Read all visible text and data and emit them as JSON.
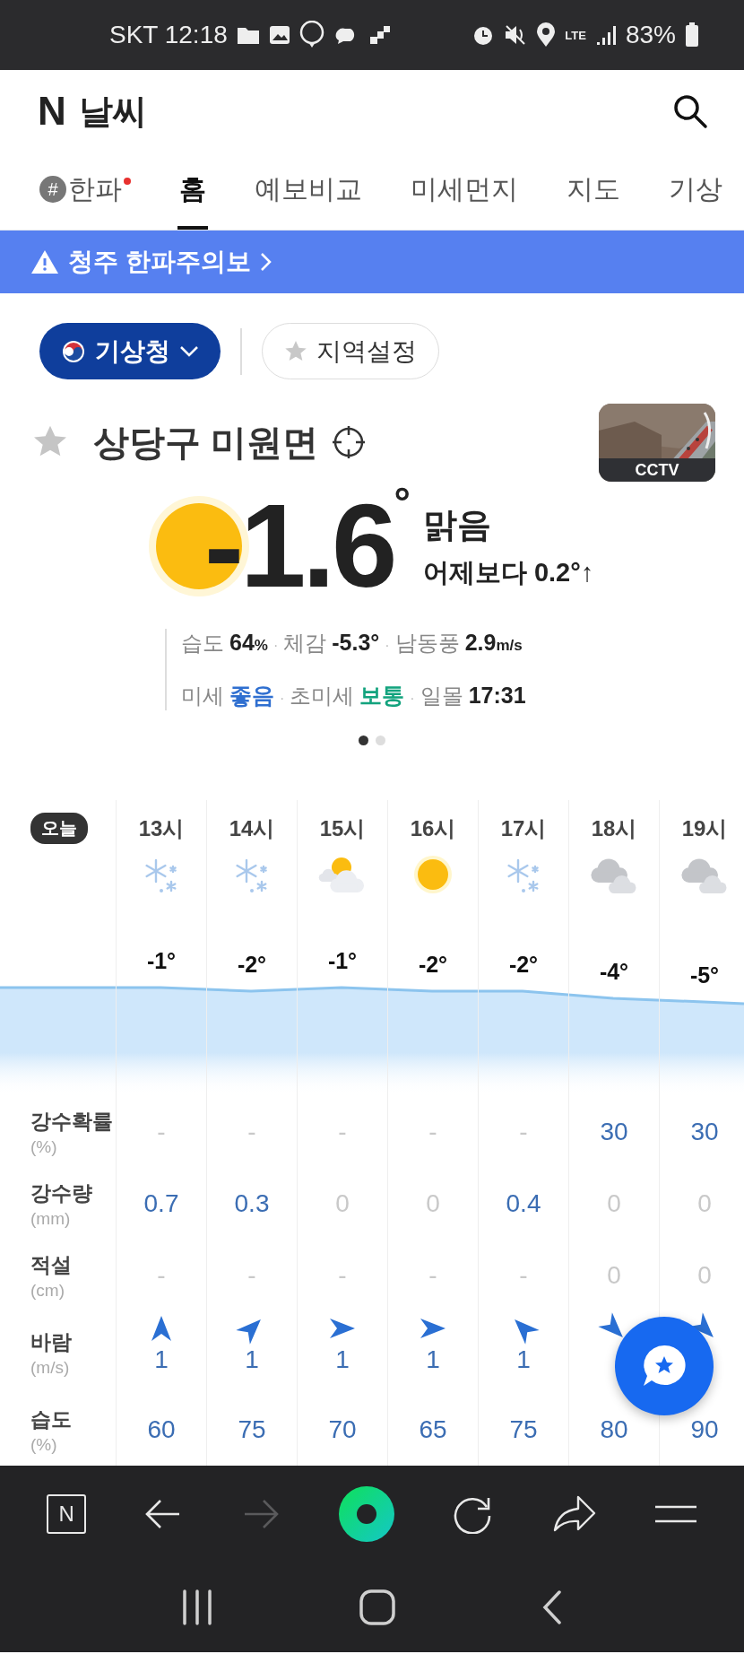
{
  "status_bar": {
    "carrier_time": "SKT 12:18",
    "network": "LTE",
    "battery": "83%"
  },
  "header": {
    "logo": "N",
    "title": "날씨"
  },
  "tabs": [
    {
      "hashtag": "#",
      "label": "한파",
      "alert": true,
      "selected": false
    },
    {
      "label": "홈",
      "alert": false,
      "selected": true
    },
    {
      "label": "예보비교",
      "alert": false,
      "selected": false
    },
    {
      "label": "미세먼지",
      "alert": false,
      "selected": false
    },
    {
      "label": "지도",
      "alert": false,
      "selected": false
    },
    {
      "label": "기상",
      "alert": false,
      "selected": false
    }
  ],
  "banner": {
    "text": "청주 한파주의보"
  },
  "source_button": {
    "label": "기상청"
  },
  "region_button": {
    "label": "지역설정"
  },
  "location": {
    "name": "상당구 미원면",
    "favorite": false
  },
  "cctv": {
    "label": "CCTV"
  },
  "current": {
    "kind": "sun",
    "temperature": "-1.6$^{°}$",
    "condition": "맑음",
    "comparison": "어제보다 0.2°↑"
  },
  "details": {
    "separator": "·",
    "lines": [
      [
        {
          "label": "습도",
          "value": "64",
          "unit": "%",
          "color": "#222222"
        },
        {
          "label": "체감",
          "value": "-5.3°",
          "color": "#222222"
        },
        {
          "label": "남동풍",
          "value": "2.9",
          "unit": "m/s",
          "color": "#222222"
        }
      ],
      [
        {
          "label": "미세",
          "value": "좋음",
          "color": "#2f6fd0"
        },
        {
          "label": "초미세",
          "value": "보통",
          "color": "#13a37e"
        },
        {
          "label": "일몰",
          "value": "17:31",
          "color": "#222222"
        }
      ]
    ]
  },
  "pager": [
    {
      "selected": true
    },
    {
      "selected": false
    }
  ],
  "hourly": {
    "day_label": "오늘",
    "hours": [
      {
        "time": "13시",
        "kind": "snow",
        "temp": "-1°"
      },
      {
        "time": "14시",
        "kind": "snow",
        "temp": "-2°"
      },
      {
        "time": "15시",
        "kind": "partly-cloudy",
        "temp": "-1°"
      },
      {
        "time": "16시",
        "kind": "sun",
        "temp": "-2°"
      },
      {
        "time": "17시",
        "kind": "snow",
        "temp": "-2°"
      },
      {
        "time": "18시",
        "kind": "cloudy",
        "temp": "-4°"
      },
      {
        "time": "19시",
        "kind": "cloudy",
        "temp": "-5°"
      }
    ]
  },
  "rows": [
    {
      "label": "강수확률",
      "unit": "(%)",
      "kind": "value",
      "cells": [
        {
          "text": "-",
          "dim": true
        },
        {
          "text": "-",
          "dim": true
        },
        {
          "text": "-",
          "dim": true
        },
        {
          "text": "-",
          "dim": true
        },
        {
          "text": "-",
          "dim": true
        },
        {
          "text": "30",
          "dim": false
        },
        {
          "text": "30",
          "dim": false
        }
      ]
    },
    {
      "label": "강수량",
      "unit": "(mm)",
      "kind": "value",
      "cells": [
        {
          "text": "0.7",
          "dim": false
        },
        {
          "text": "0.3",
          "dim": false
        },
        {
          "text": "0",
          "dim": true
        },
        {
          "text": "0",
          "dim": true
        },
        {
          "text": "0.4",
          "dim": false
        },
        {
          "text": "0",
          "dim": true
        },
        {
          "text": "0",
          "dim": true
        }
      ]
    },
    {
      "label": "적설",
      "unit": "(cm)",
      "kind": "value",
      "cells": [
        {
          "text": "-",
          "dim": true
        },
        {
          "text": "-",
          "dim": true
        },
        {
          "text": "-",
          "dim": true
        },
        {
          "text": "-",
          "dim": true
        },
        {
          "text": "-",
          "dim": true
        },
        {
          "text": "0",
          "dim": true
        },
        {
          "text": "0",
          "dim": true
        }
      ]
    },
    {
      "label": "바람",
      "unit": "(m/s)",
      "kind": "wind",
      "cells": [
        {
          "text": "1",
          "kind": "north"
        },
        {
          "text": "1",
          "kind": "northeast"
        },
        {
          "text": "1",
          "kind": "east"
        },
        {
          "text": "1",
          "kind": "east"
        },
        {
          "text": "1",
          "kind": "northwest"
        },
        {
          "kind": "southeast"
        },
        {
          "kind": "southeast"
        }
      ]
    },
    {
      "label": "습도",
      "unit": "(%)",
      "kind": "value",
      "cells": [
        {
          "text": "60",
          "dim": false
        },
        {
          "text": "75",
          "dim": false
        },
        {
          "text": "70",
          "dim": false
        },
        {
          "text": "65",
          "dim": false
        },
        {
          "text": "75",
          "dim": false
        },
        {
          "text": "80",
          "dim": false
        },
        {
          "text": "90",
          "dim": false
        }
      ]
    }
  ],
  "toolbar": [
    {
      "kind": "n-logo",
      "label": "N",
      "disabled": false
    },
    {
      "kind": "back",
      "disabled": false
    },
    {
      "kind": "forward",
      "disabled": true
    },
    {
      "kind": "green-ring",
      "disabled": false
    },
    {
      "kind": "reload",
      "disabled": false
    },
    {
      "kind": "share",
      "disabled": false
    },
    {
      "kind": "menu",
      "disabled": false
    }
  ],
  "nav": [
    {
      "kind": "recents"
    },
    {
      "kind": "home"
    },
    {
      "kind": "back"
    }
  ]
}
